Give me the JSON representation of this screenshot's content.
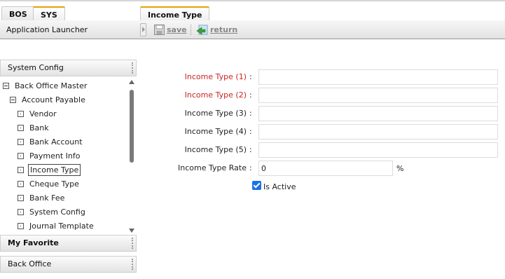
{
  "tabs": {
    "left": [
      {
        "label": "BOS"
      },
      {
        "label": "SYS"
      }
    ],
    "document": {
      "label": "Income Type"
    }
  },
  "toolbar": {
    "app_launcher": "Application Launcher",
    "save": "save",
    "return": "return"
  },
  "sidebar": {
    "system_config_header": "System Config",
    "tree": [
      {
        "label": "Back Office Master",
        "icon": "minus"
      },
      {
        "label": "Account Payable",
        "icon": "minus"
      },
      {
        "label": "Vendor",
        "icon": "leaf"
      },
      {
        "label": "Bank",
        "icon": "leaf"
      },
      {
        "label": "Bank Account",
        "icon": "leaf"
      },
      {
        "label": "Payment Info",
        "icon": "leaf"
      },
      {
        "label": "Income Type",
        "icon": "leaf",
        "selected": true
      },
      {
        "label": "Cheque Type",
        "icon": "leaf"
      },
      {
        "label": "Bank Fee",
        "icon": "leaf"
      },
      {
        "label": "System Config",
        "icon": "leaf"
      },
      {
        "label": "Journal Template",
        "icon": "leaf"
      }
    ],
    "my_favorite_header": "My Favorite",
    "back_office_header": "Back Office"
  },
  "form": {
    "fields": [
      {
        "label": "Income Type (1)",
        "required": true,
        "value": ""
      },
      {
        "label": "Income Type (2)",
        "required": true,
        "value": ""
      },
      {
        "label": "Income Type (3)",
        "required": false,
        "value": ""
      },
      {
        "label": "Income Type (4)",
        "required": false,
        "value": ""
      },
      {
        "label": "Income Type (5)",
        "required": false,
        "value": ""
      }
    ],
    "rate": {
      "label": "Income Type Rate",
      "value": "0",
      "unit": "%"
    },
    "is_active": {
      "label": "Is Active",
      "checked": true
    },
    "colon": ":"
  },
  "colors": {
    "required_label": "#cc2222",
    "active_tab_accent": "#e8a000",
    "checkbox": "#1a73e8"
  }
}
